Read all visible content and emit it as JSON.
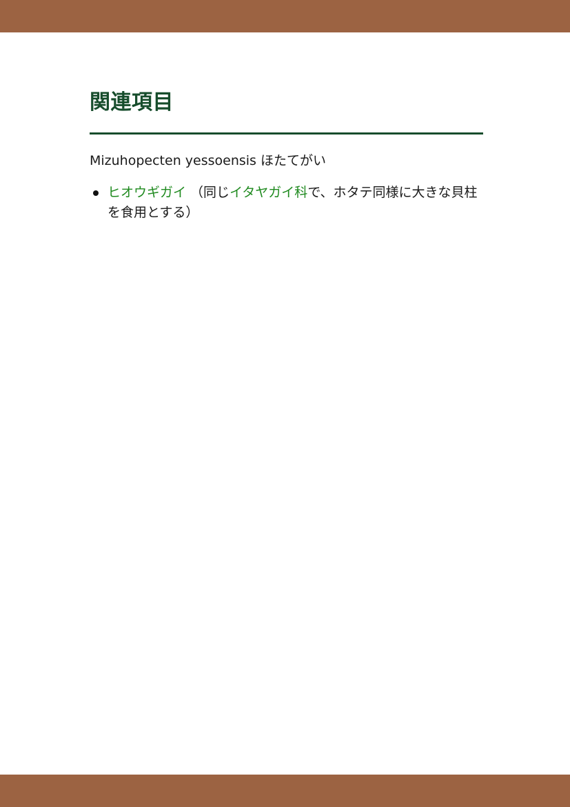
{
  "colors": {
    "band": "#9c6342",
    "heading": "#174d2c",
    "rule": "#174d2c",
    "link": "#1f8a1f",
    "text": "#1a1a1a"
  },
  "section": {
    "heading": "関連項目",
    "intro": "Mizuhopecten yessoensis ほたてがい",
    "items": [
      {
        "link1": "ヒオウギガイ",
        "text1": " （同じ",
        "link2": "イタヤガイ科",
        "text2": "で、ホタテ同様に大きな貝柱を食用とする）"
      }
    ]
  }
}
